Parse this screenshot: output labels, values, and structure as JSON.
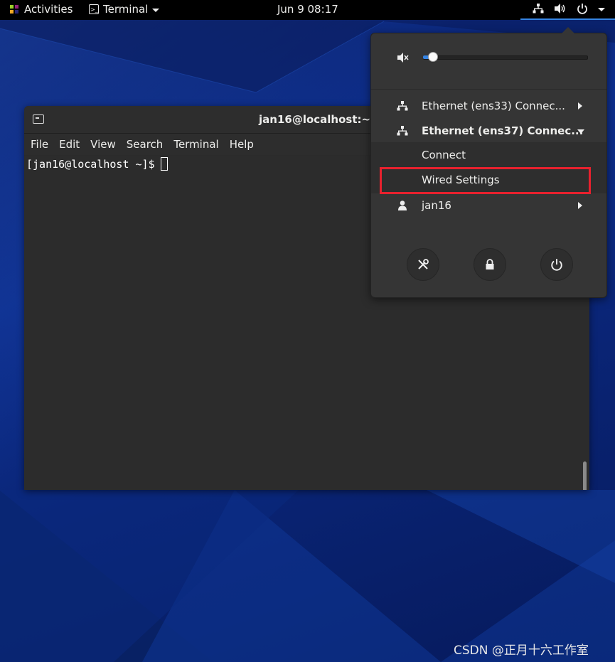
{
  "topbar": {
    "activities_label": "Activities",
    "app_menu_label": "Terminal",
    "clock": "Jun 9  08:17"
  },
  "terminal": {
    "title": "jan16@localhost:~",
    "menu": [
      "File",
      "Edit",
      "View",
      "Search",
      "Terminal",
      "Help"
    ],
    "prompt": "[jan16@localhost ~]$"
  },
  "status_menu": {
    "volume_level": 0.05,
    "network_items": [
      {
        "label": "Ethernet (ens33) Connec...",
        "expanded": false
      },
      {
        "label": "Ethernet (ens37) Connec...",
        "expanded": true
      }
    ],
    "submenu": {
      "connect_label": "Connect",
      "wired_settings_label": "Wired Settings"
    },
    "user_label": "jan16",
    "actions": [
      "settings-icon",
      "lock-icon",
      "power-icon"
    ]
  },
  "colors": {
    "accent": "#3584e4",
    "highlight_box": "#e8212e"
  },
  "watermark": "CSDN @正月十六工作室"
}
